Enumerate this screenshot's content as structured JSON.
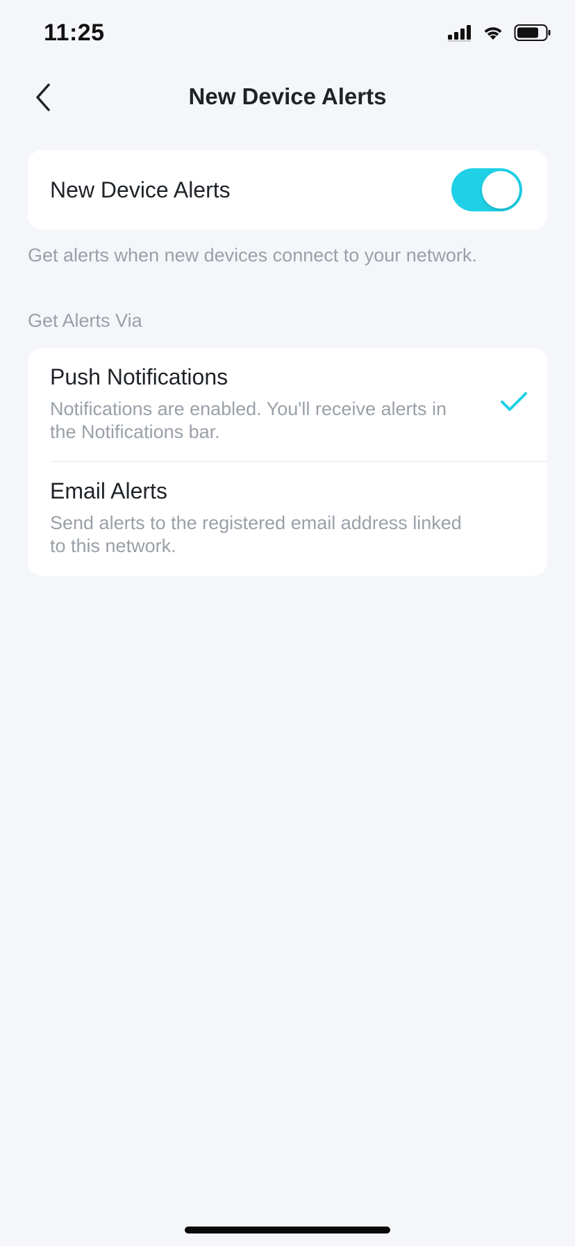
{
  "status_bar": {
    "time": "11:25",
    "icons": [
      "cellular-signal-icon",
      "wifi-icon",
      "battery-icon"
    ]
  },
  "nav": {
    "back_icon": "chevron-left-icon",
    "title": "New Device Alerts"
  },
  "toggle": {
    "label": "New Device Alerts",
    "enabled": true,
    "accent_color": "#1fd0e6"
  },
  "description": "Get alerts when new devices connect to your network.",
  "alerts_section": {
    "header": "Get Alerts Via",
    "options": [
      {
        "title": "Push Notifications",
        "subtitle": "Notifications are enabled. You'll receive alerts in the Notifications bar.",
        "selected": true,
        "icon": "checkmark-icon"
      },
      {
        "title": "Email Alerts",
        "subtitle": "Send alerts to the registered email address linked to this network.",
        "selected": false
      }
    ]
  }
}
